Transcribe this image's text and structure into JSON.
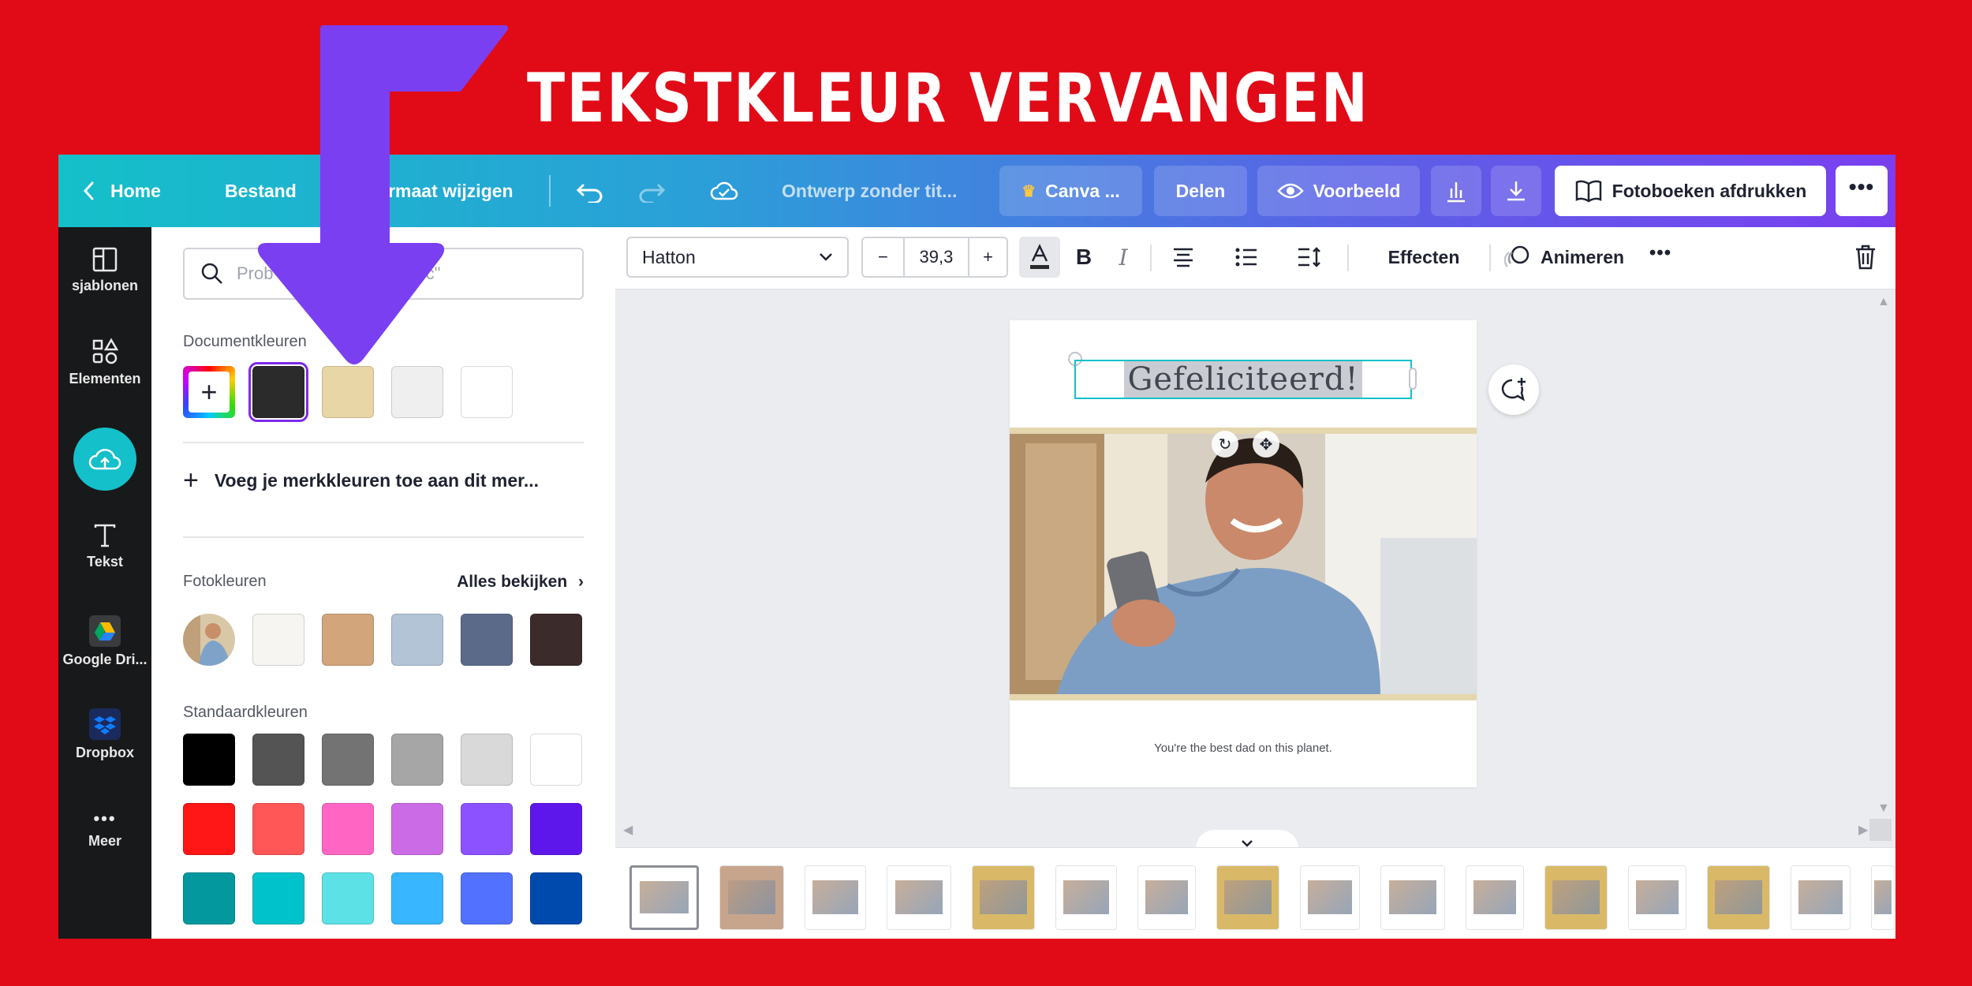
{
  "banner": {
    "title": "TEKSTKLEUR VERVANGEN"
  },
  "topbar": {
    "home": "Home",
    "file": "Bestand",
    "resize": "Formaat wijzigen",
    "doc_title": "Ontwerp zonder tit...",
    "canva_pro": "Canva ...",
    "share": "Delen",
    "preview": "Voorbeeld",
    "print": "Fotoboeken afdrukken"
  },
  "sidebar": {
    "items": [
      {
        "label": "sjablonen",
        "icon": "templates-icon"
      },
      {
        "label": "Elementen",
        "icon": "elements-icon"
      },
      {
        "label": "Tekst",
        "icon": "text-icon"
      },
      {
        "label": "Google Dri...",
        "icon": "google-drive-icon"
      },
      {
        "label": "Dropbox",
        "icon": "dropbox-icon"
      },
      {
        "label": "Meer",
        "icon": "more-icon"
      }
    ]
  },
  "panel": {
    "search_placeholder": "Probeer \"blauw\" of \"#00c4cc\"",
    "search_visible": "Prob                        0c4cc\"",
    "document_colors_label": "Documentkleuren",
    "document_colors": [
      "#2b2b2b",
      "#e8d6a6",
      "#efefef",
      "#ffffff"
    ],
    "add_brand": "Voeg je merkkleuren toe aan dit mer...",
    "photo_colors_label": "Fotokleuren",
    "see_all": "Alles bekijken",
    "photo_colors": [
      "#f6f5f1",
      "#d2a57a",
      "#b2c4d6",
      "#5b6a89",
      "#3b2b2a"
    ],
    "default_colors_label": "Standaardkleuren",
    "default_colors": [
      [
        "#000000",
        "#545454",
        "#737373",
        "#a6a6a6",
        "#d9d9d9",
        "#ffffff"
      ],
      [
        "#ff1616",
        "#ff5757",
        "#ff66c4",
        "#cb6ce6",
        "#8c52ff",
        "#5e17eb"
      ],
      [
        "#03989e",
        "#00c2cb",
        "#5ce1e6",
        "#38b6ff",
        "#5271ff",
        "#004aad"
      ]
    ]
  },
  "toolbar": {
    "font": "Hatton",
    "size": "39,3",
    "minus": "−",
    "plus": "+",
    "bold": "B",
    "italic": "I",
    "effects": "Effecten",
    "animate": "Animeren"
  },
  "page": {
    "heading": "Gefeliciteerd!",
    "caption": "You're the best dad on this planet."
  },
  "colors": {
    "accent": "#14c0c9",
    "selection": "#7d2ae8",
    "arrow": "#7b3ff2",
    "banner_bg": "#e10a17"
  }
}
